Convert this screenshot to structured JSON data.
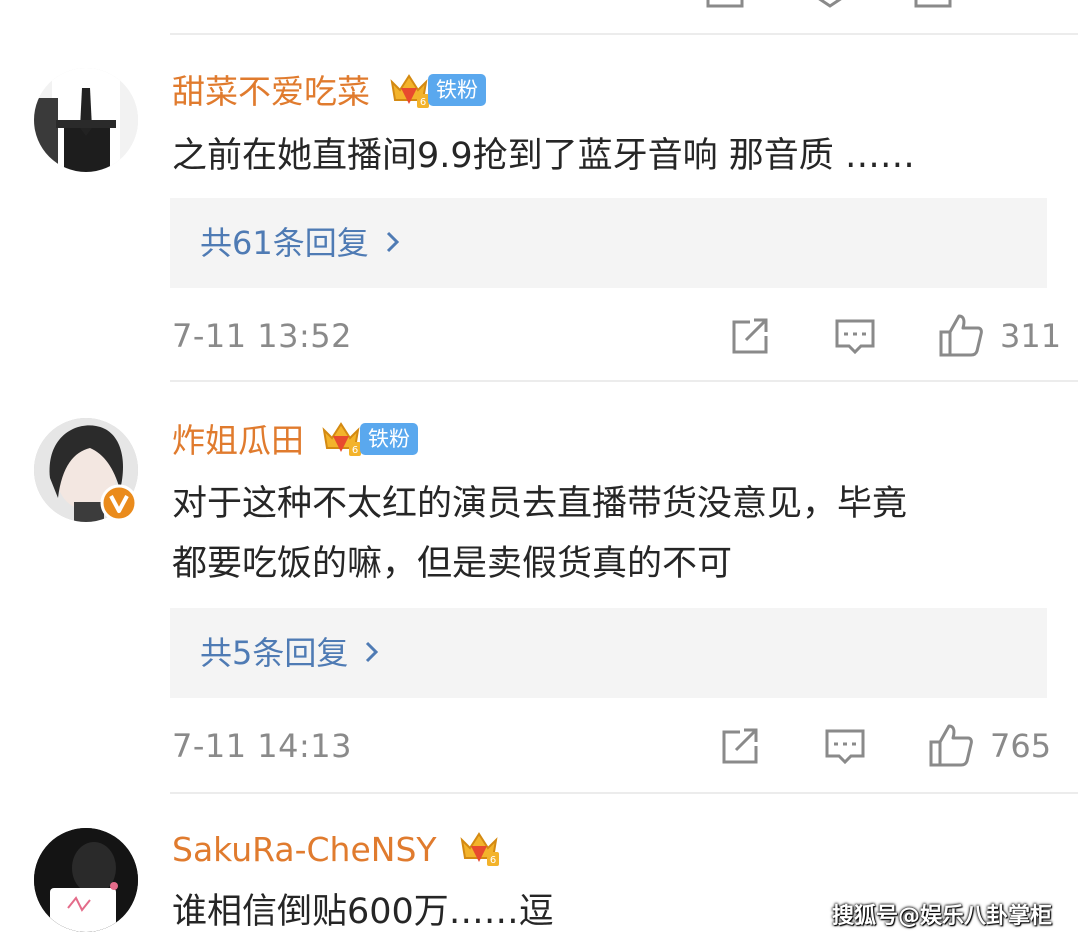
{
  "comments": [
    {
      "username": "甜菜不爱吃菜",
      "fan_badge": "铁粉",
      "crown_level": "6",
      "text": "之前在她直播间9.9抢到了蓝牙音响  那音质 ……",
      "replies_label": "共61条回复",
      "time": "7-11 13:52",
      "likes": "311"
    },
    {
      "username": "炸姐瓜田",
      "fan_badge": "铁粉",
      "crown_level": "6",
      "text_line1": "对于这种不太红的演员去直播带货没意见，毕竟",
      "text_line2": "都要吃饭的嘛，但是卖假货真的不可",
      "replies_label": "共5条回复",
      "time": "7-11 14:13",
      "likes": "765"
    },
    {
      "username": "SakuRa-CheNSY",
      "crown_level": "6",
      "text": "谁相信倒贴600万……逗"
    }
  ],
  "watermark": "搜狐号@娱乐八卦掌柜",
  "icons": [
    "share-icon",
    "comment-icon",
    "like-icon",
    "crown-badge-icon",
    "chevron-right-icon",
    "verified-v-icon"
  ],
  "colors": {
    "username": "#e07b2e",
    "reply_link": "#4f7bb4",
    "fan_badge": "#5aa8ee",
    "meta": "#8a8a8a"
  }
}
